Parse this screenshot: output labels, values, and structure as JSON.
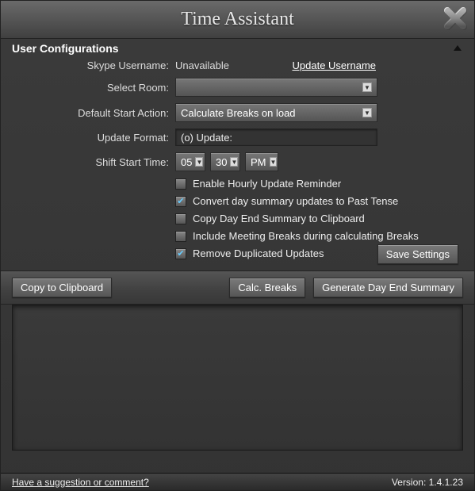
{
  "window": {
    "title": "Time Assistant"
  },
  "section": {
    "header": "User Configurations"
  },
  "labels": {
    "skype": "Skype Username:",
    "room": "Select Room:",
    "default_action": "Default Start Action:",
    "update_format": "Update Format:",
    "shift_start": "Shift Start Time:"
  },
  "values": {
    "skype_username": "Unavailable",
    "update_username_link": "Update Username",
    "select_room": "",
    "default_action": "Calculate Breaks on load",
    "update_format": "(o) Update:",
    "shift_hour": "05",
    "shift_minute": "30",
    "shift_ampm": "PM"
  },
  "checks": {
    "enable_hourly": {
      "label": "Enable Hourly Update Reminder",
      "checked": false
    },
    "past_tense": {
      "label": "Convert day summary updates to Past Tense",
      "checked": true
    },
    "copy_day_end": {
      "label": "Copy Day End Summary to Clipboard",
      "checked": false
    },
    "include_meeting": {
      "label": "Include Meeting Breaks during calculating Breaks",
      "checked": false
    },
    "remove_dup": {
      "label": "Remove Duplicated Updates",
      "checked": true
    }
  },
  "buttons": {
    "save": "Save Settings",
    "copy_clipboard": "Copy to Clipboard",
    "calc_breaks": "Calc. Breaks",
    "gen_summary": "Generate Day End Summary"
  },
  "footer": {
    "suggestion": "Have a suggestion or comment?",
    "version": "Version: 1.4.1.23"
  },
  "colors": {
    "accent_check": "#6cf"
  }
}
